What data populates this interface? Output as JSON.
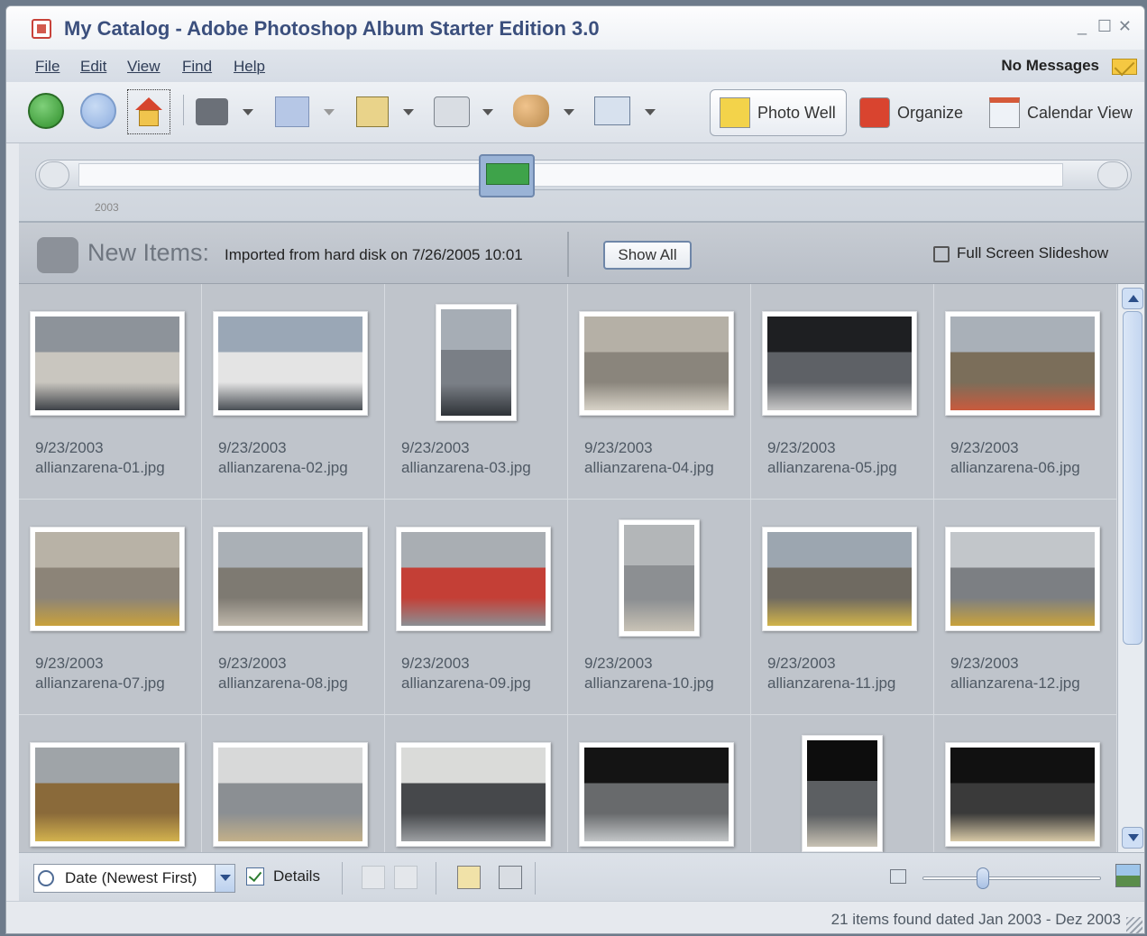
{
  "window": {
    "title": "My Catalog - Adobe Photoshop Album Starter Edition 3.0",
    "min_glyph": "_",
    "max_glyph": "☐",
    "close_glyph": "✕"
  },
  "menu": [
    "File",
    "Edit",
    "View",
    "Find",
    "Help"
  ],
  "messages": "No Messages",
  "toolbar": {
    "views": [
      {
        "label": "Photo Well",
        "icon": "photo-well-icon"
      },
      {
        "label": "Organize",
        "icon": "organize-icon"
      },
      {
        "label": "Calendar View",
        "icon": "calendar-icon"
      }
    ]
  },
  "timeline": {
    "year": "2003"
  },
  "status": {
    "heading": "New Items:",
    "detail": "Imported from hard disk on 7/26/2005 10:01",
    "show_all": "Show All",
    "slideshow": "Full Screen Slideshow"
  },
  "photos": [
    {
      "date": "9/23/2003",
      "name": "allianzarena-01.jpg",
      "orient": "landscape"
    },
    {
      "date": "9/23/2003",
      "name": "allianzarena-02.jpg",
      "orient": "landscape"
    },
    {
      "date": "9/23/2003",
      "name": "allianzarena-03.jpg",
      "orient": "portrait"
    },
    {
      "date": "9/23/2003",
      "name": "allianzarena-04.jpg",
      "orient": "landscape"
    },
    {
      "date": "9/23/2003",
      "name": "allianzarena-05.jpg",
      "orient": "landscape"
    },
    {
      "date": "9/23/2003",
      "name": "allianzarena-06.jpg",
      "orient": "landscape"
    },
    {
      "date": "9/23/2003",
      "name": "allianzarena-07.jpg",
      "orient": "landscape"
    },
    {
      "date": "9/23/2003",
      "name": "allianzarena-08.jpg",
      "orient": "landscape"
    },
    {
      "date": "9/23/2003",
      "name": "allianzarena-09.jpg",
      "orient": "landscape"
    },
    {
      "date": "9/23/2003",
      "name": "allianzarena-10.jpg",
      "orient": "portrait"
    },
    {
      "date": "9/23/2003",
      "name": "allianzarena-11.jpg",
      "orient": "landscape"
    },
    {
      "date": "9/23/2003",
      "name": "allianzarena-12.jpg",
      "orient": "landscape"
    },
    {
      "date": "",
      "name": "",
      "orient": "landscape"
    },
    {
      "date": "",
      "name": "",
      "orient": "landscape"
    },
    {
      "date": "",
      "name": "",
      "orient": "landscape"
    },
    {
      "date": "",
      "name": "",
      "orient": "landscape"
    },
    {
      "date": "",
      "name": "",
      "orient": "portrait"
    },
    {
      "date": "",
      "name": "",
      "orient": "landscape"
    }
  ],
  "bottom": {
    "sort": "Date (Newest First)",
    "details_label": "Details",
    "details_checked": true
  },
  "footer": "21 items found dated Jan 2003 - Dez 2003",
  "colors": {
    "title": "#3b4f7d",
    "accent": "#2c4f8a"
  }
}
